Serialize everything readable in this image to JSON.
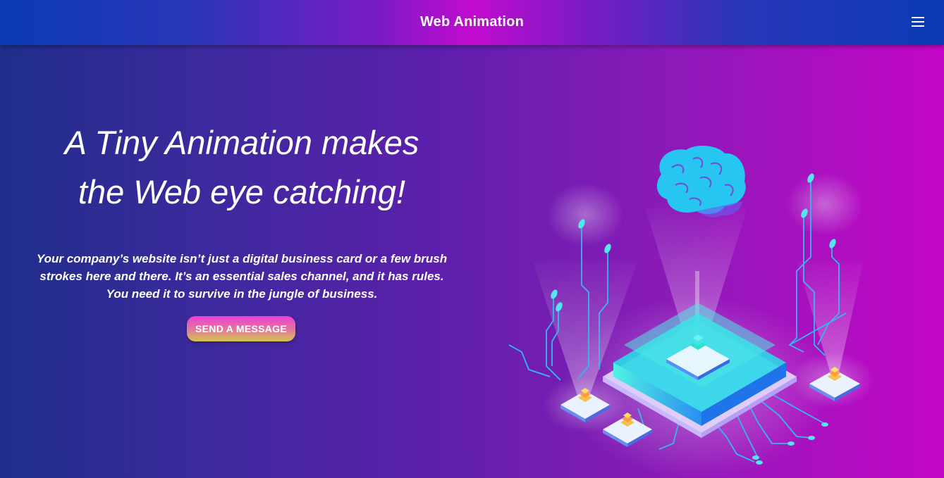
{
  "header": {
    "title": "Web Animation",
    "menu_icon": "hamburger-menu-icon"
  },
  "hero": {
    "heading_line1": "A Tiny Animation makes",
    "heading_line2": "the Web eye catching!",
    "body_line1": "Your company’s website isn’t just a digital business card or a few brush",
    "body_line2": "strokes here and there. It’s an essential sales channel, and it has rules.",
    "body_line3": "You need it to survive in the jungle of business.",
    "cta_label": "SEND A MESSAGE"
  },
  "illustration": {
    "name": "ai-brain-circuit-illustration",
    "colors": {
      "brain": "#27c6f0",
      "chip_top": "#3fe8e0",
      "circuit": "#2fb8ea",
      "node": "#5fe6f0"
    }
  }
}
